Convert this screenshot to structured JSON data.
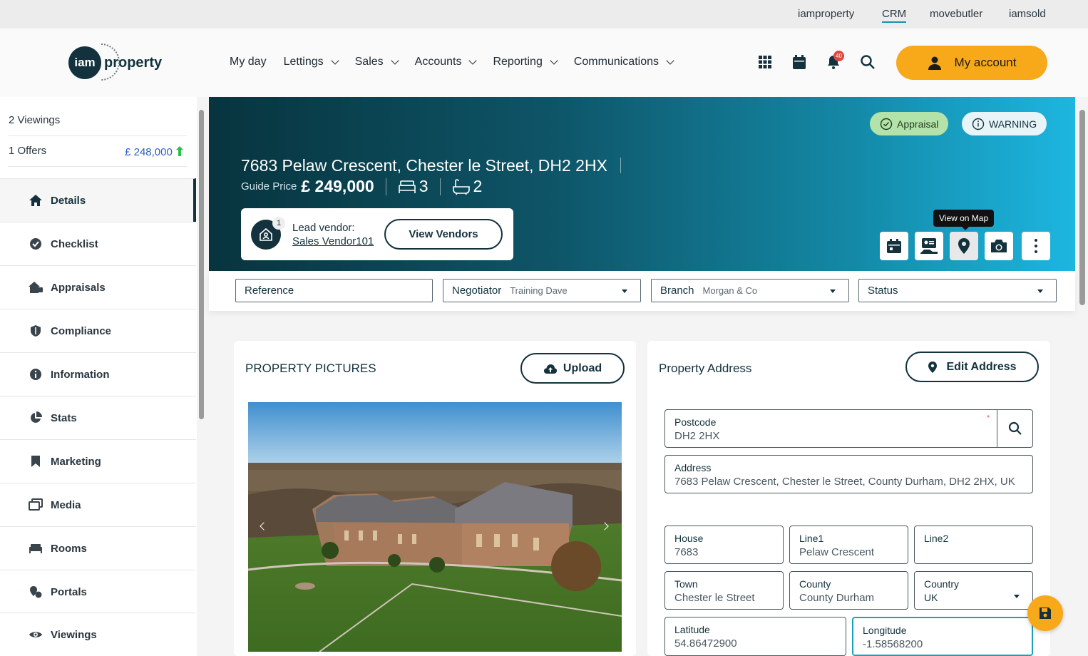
{
  "topbar": {
    "links": [
      "iamproperty",
      "CRM",
      "movebutler",
      "iamsold"
    ],
    "active": "CRM"
  },
  "header": {
    "logo_left": "iam",
    "logo_right": "property",
    "nav": [
      "My day",
      "Lettings",
      "Sales",
      "Accounts",
      "Reporting",
      "Communications"
    ],
    "notification_count": "40",
    "account_label": "My account",
    "accent_color": "#f7a91a",
    "icons": [
      "grid-icon",
      "calendar-icon",
      "bell-icon",
      "search-icon"
    ]
  },
  "sidebar": {
    "viewings_summary": "2 Viewings",
    "offers_summary": "1 Offers",
    "offer_value": "£ 248,000",
    "items": [
      {
        "label": "Details",
        "icon": "home-icon",
        "active": true
      },
      {
        "label": "Checklist",
        "icon": "check-circle-icon"
      },
      {
        "label": "Appraisals",
        "icon": "house-tag-icon"
      },
      {
        "label": "Compliance",
        "icon": "shield-icon"
      },
      {
        "label": "Information",
        "icon": "info-icon"
      },
      {
        "label": "Stats",
        "icon": "pie-chart-icon"
      },
      {
        "label": "Marketing",
        "icon": "bookmark-icon"
      },
      {
        "label": "Media",
        "icon": "images-icon"
      },
      {
        "label": "Rooms",
        "icon": "bed-icon"
      },
      {
        "label": "Portals",
        "icon": "map-pin-icon"
      },
      {
        "label": "Viewings",
        "icon": "eye-icon"
      }
    ]
  },
  "hero": {
    "address": "7683 Pelaw Crescent, Chester le Street, DH2 2HX",
    "guide_label": "Guide Price",
    "guide_price": "£ 249,000",
    "bedrooms": "3",
    "bathrooms": "2",
    "pill_appraisal": "Appraisal",
    "pill_warning": "WARNING",
    "vendor_count": "1",
    "vendor_label": "Lead vendor:",
    "vendor_name": "Sales Vendor101",
    "view_vendors": "View Vendors",
    "tooltip": "View on Map"
  },
  "filters": {
    "reference": "Reference",
    "negotiator_label": "Negotiator",
    "negotiator_value": "Training Dave",
    "branch_label": "Branch",
    "branch_value": "Morgan & Co",
    "status_label": "Status"
  },
  "pictures": {
    "title": "PROPERTY PICTURES",
    "upload": "Upload"
  },
  "address_card": {
    "title": "Property Address",
    "edit": "Edit Address",
    "fields": {
      "postcode": {
        "label": "Postcode",
        "value": "DH2 2HX"
      },
      "address": {
        "label": "Address",
        "value": "7683 Pelaw Crescent, Chester le Street, County Durham, DH2 2HX, UK"
      },
      "house": {
        "label": "House",
        "value": "7683"
      },
      "line1": {
        "label": "Line1",
        "value": "Pelaw Crescent"
      },
      "line2": {
        "label": "Line2",
        "value": ""
      },
      "town": {
        "label": "Town",
        "value": "Chester le Street"
      },
      "county": {
        "label": "County",
        "value": "County Durham"
      },
      "country": {
        "label": "Country",
        "value": "UK"
      },
      "latitude": {
        "label": "Latitude",
        "value": "54.86472900"
      },
      "longitude": {
        "label": "Longitude",
        "value": "-1.58568200"
      }
    },
    "required_mark": "*"
  }
}
